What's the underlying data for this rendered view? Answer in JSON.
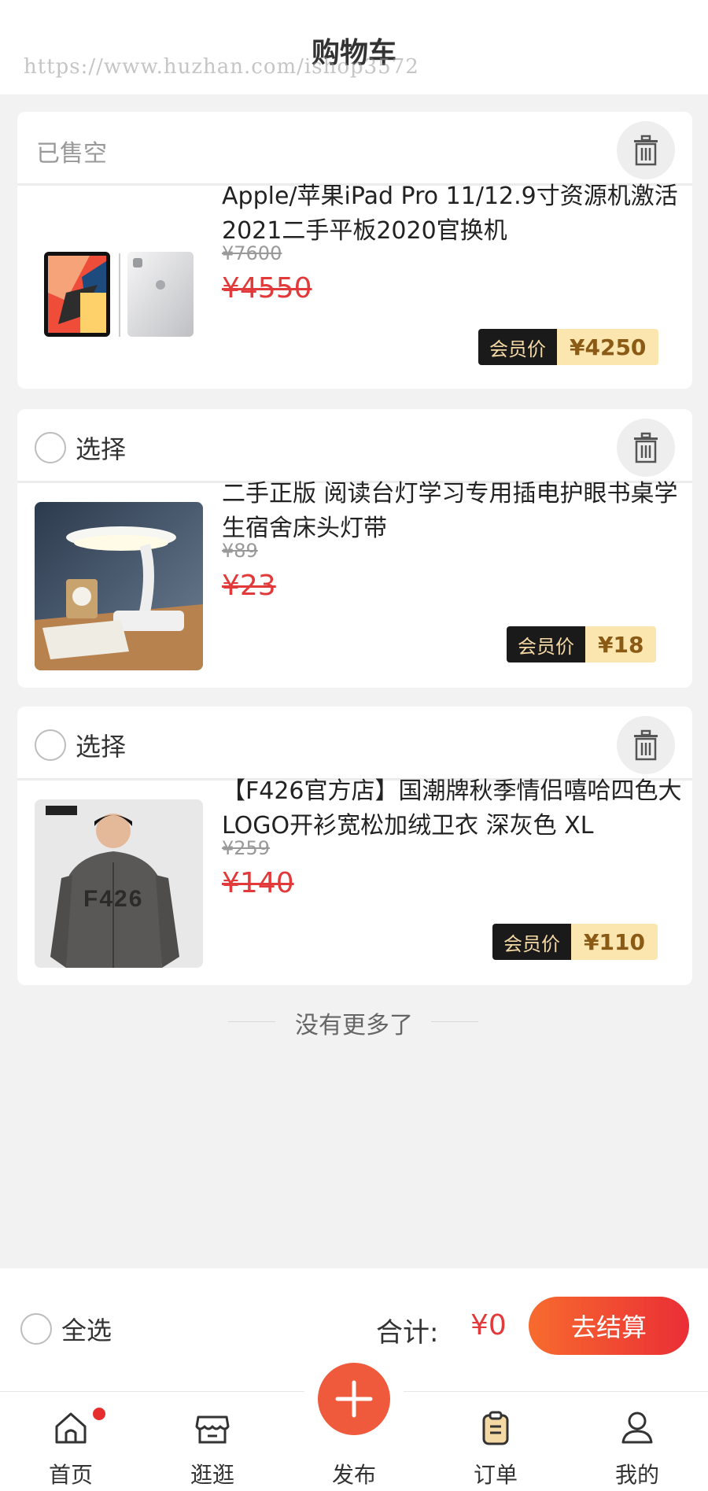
{
  "header": {
    "title": "购物车",
    "watermark": "https://www.huzhan.com/ishop3572"
  },
  "items": [
    {
      "status": "已售空",
      "select_label": "",
      "title": "Apple/苹果iPad Pro 11/12.9寸资源机激活2021二手平板2020官换机",
      "orig_price": "¥7600",
      "price": "¥4550",
      "member_label": "会员价",
      "member_price": "¥4250",
      "thumb_icon": "ipad-pro-image"
    },
    {
      "status": "",
      "select_label": "选择",
      "title": "二手正版 阅读台灯学习专用插电护眼书桌学生宿舍床头灯带",
      "orig_price": "¥89",
      "price": "¥23",
      "member_label": "会员价",
      "member_price": "¥18",
      "thumb_icon": "desk-lamp-image"
    },
    {
      "status": "",
      "select_label": "选择",
      "title": "【F426官方店】国潮牌秋季情侣嘻哈四色大LOGO开衫宽松加绒卫衣 深灰色 XL",
      "orig_price": "¥259",
      "price": "¥140",
      "member_label": "会员价",
      "member_price": "¥110",
      "thumb_icon": "hoodie-image",
      "thumb_text": "F426"
    }
  ],
  "no_more": "没有更多了",
  "bottom": {
    "select_all": "全选",
    "total_label": "合计:",
    "total_value": "¥0",
    "checkout": "去结算"
  },
  "tabs": [
    {
      "label": "首页",
      "icon": "home-icon"
    },
    {
      "label": "逛逛",
      "icon": "shop-icon"
    },
    {
      "label": "发布",
      "icon": "plus-icon"
    },
    {
      "label": "订单",
      "icon": "clipboard-icon"
    },
    {
      "label": "我的",
      "icon": "user-icon"
    }
  ],
  "colors": {
    "accent_red": "#e23a3a",
    "checkout_gradient_start": "#f76b2e",
    "checkout_gradient_end": "#ea2e36",
    "member_label_bg": "#1a1a1a",
    "member_value_bg": "#fbe6b0"
  }
}
